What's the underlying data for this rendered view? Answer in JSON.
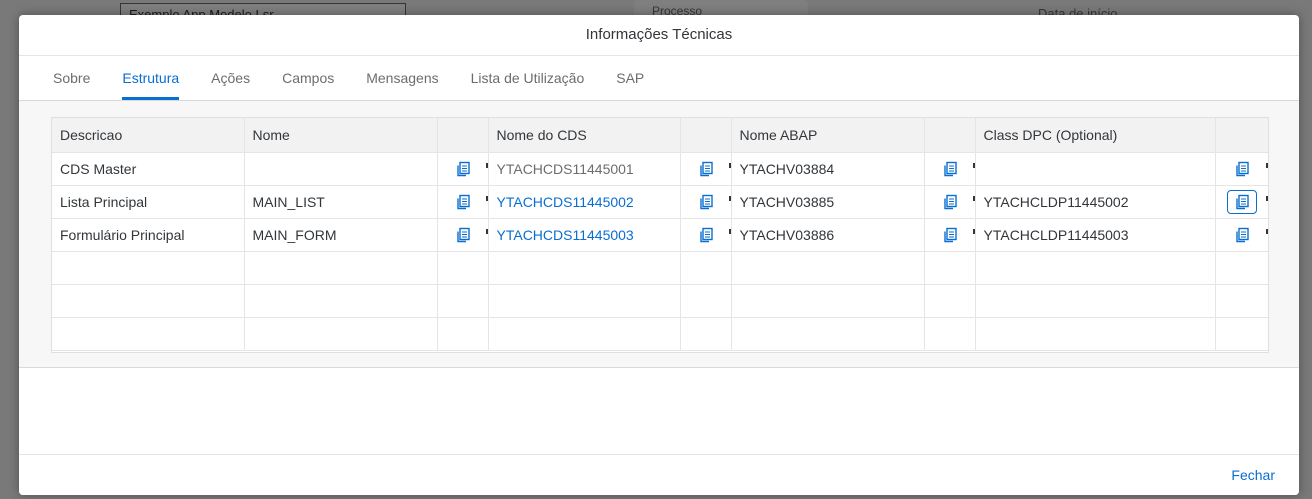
{
  "background": {
    "input_text": "Exemplo App Modelo Lsr",
    "card_text": "Processo",
    "label": "Data de início"
  },
  "dialog": {
    "title": "Informações Técnicas",
    "tabs": [
      {
        "label": "Sobre",
        "active": false
      },
      {
        "label": "Estrutura",
        "active": true
      },
      {
        "label": "Ações",
        "active": false
      },
      {
        "label": "Campos",
        "active": false
      },
      {
        "label": "Mensagens",
        "active": false
      },
      {
        "label": "Lista de Utilização",
        "active": false
      },
      {
        "label": "SAP",
        "active": false
      }
    ],
    "table": {
      "columns": [
        "Descricao",
        "Nome",
        "",
        "Nome do CDS",
        "",
        "Nome ABAP",
        "",
        "Class DPC (Optional)",
        ""
      ],
      "rows": [
        {
          "descricao": "CDS Master",
          "nome": "",
          "cds": "YTACHCDS11445001",
          "abap": "YTACHV03884",
          "dpc": ""
        },
        {
          "descricao": "Lista Principal",
          "nome": "MAIN_LIST",
          "cds": "YTACHCDS11445002",
          "abap": "YTACHV03885",
          "dpc": "YTACHCLDP11445002"
        },
        {
          "descricao": "Formulário Principal",
          "nome": "MAIN_FORM",
          "cds": "YTACHCDS11445003",
          "abap": "YTACHV03886",
          "dpc": "YTACHCLDP11445003"
        }
      ]
    },
    "footer": {
      "close_label": "Fechar"
    }
  },
  "colors": {
    "accent": "#0a6ed1",
    "text": "#32363a",
    "muted": "#6a6d70"
  },
  "icons": {
    "copy": "copy-icon"
  }
}
